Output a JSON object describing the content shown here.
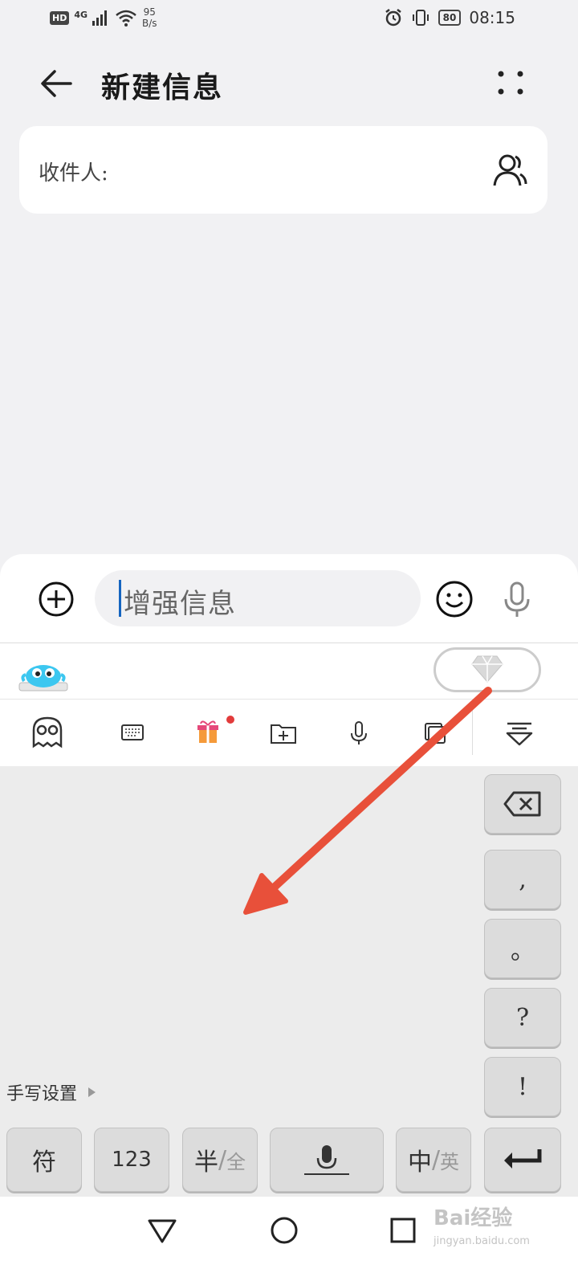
{
  "status_bar": {
    "network_badge": "HD",
    "network_type": "4G",
    "speed_value": "95",
    "speed_unit": "B/s",
    "battery": "80",
    "time": "08:15"
  },
  "header": {
    "title": "新建信息"
  },
  "recipient": {
    "label": "收件人:"
  },
  "composer": {
    "placeholder": "增强信息"
  },
  "keyboard": {
    "side_keys": [
      ",",
      "。",
      "?",
      "!"
    ],
    "handwriting_settings": "手写设置",
    "bottom_keys": {
      "symbol": "符",
      "numbers": "123",
      "half": "半",
      "full": "全",
      "chinese": "中",
      "english": "英"
    }
  },
  "icons": {
    "back": "back-arrow-icon",
    "more": "more-dots-icon",
    "contact": "contact-icon",
    "add": "add-circle-icon",
    "emoji": "emoji-icon",
    "voice": "microphone-icon",
    "vip": "diamond-icon",
    "tools": [
      "skin-icon",
      "keyboard-icon",
      "gift-icon",
      "folder-add-icon",
      "microphone-icon",
      "clipboard-icon",
      "collapse-icon"
    ],
    "backspace": "backspace-icon",
    "enter": "enter-icon",
    "nav": [
      "back-triangle-icon",
      "home-circle-icon",
      "recents-square-icon"
    ]
  },
  "colors": {
    "cursor": "#1565c0",
    "annotation_arrow": "#e8503a",
    "notification_dot": "#e23b3b"
  },
  "watermark": {
    "brand": "Bai经验",
    "site": "jingyan.baidu.com"
  }
}
